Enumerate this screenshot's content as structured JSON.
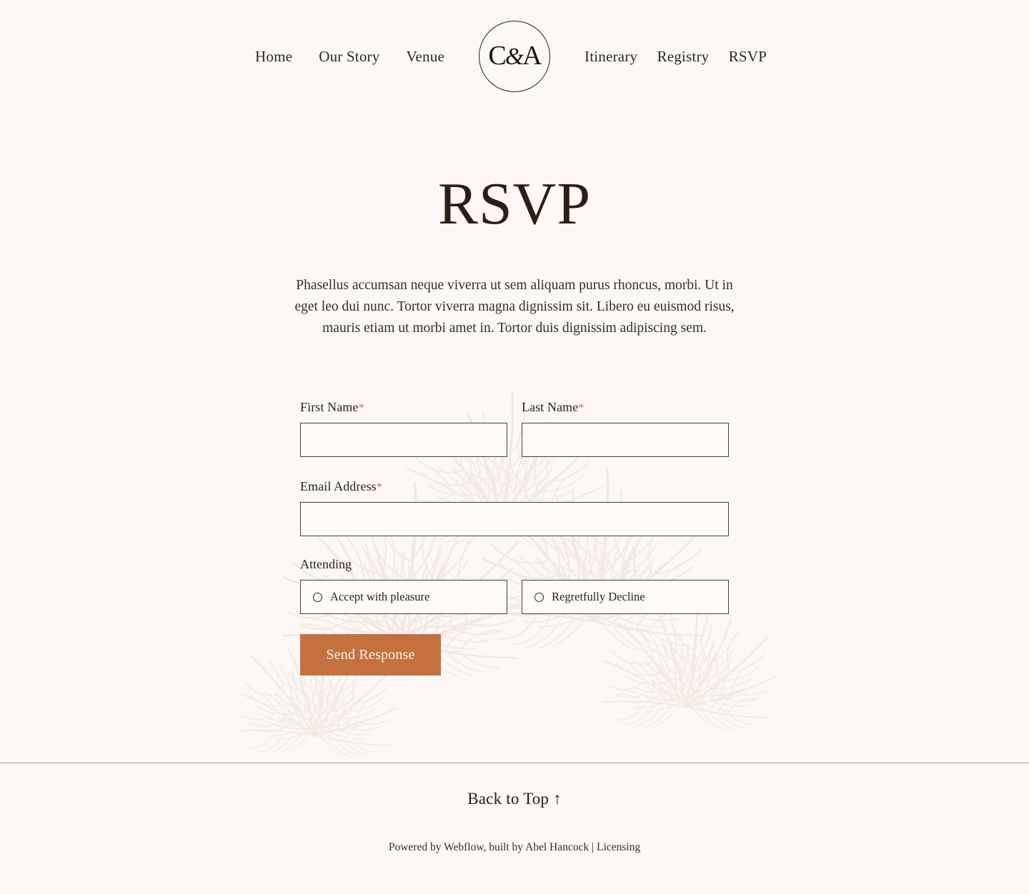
{
  "brand": {
    "logo_monogram_left": "C",
    "logo_monogram_amp": "&",
    "logo_monogram_right": "A"
  },
  "nav": {
    "left_items": [
      {
        "label": "Home"
      },
      {
        "label": "Our Story"
      },
      {
        "label": "Venue"
      }
    ],
    "right_items": [
      {
        "label": "Itinerary"
      },
      {
        "label": "Registry"
      },
      {
        "label": "RSVP"
      }
    ]
  },
  "main": {
    "title": "RSVP",
    "paragraph": "Phasellus accumsan neque viverra ut sem aliquam purus rhoncus, morbi. Ut in eget leo dui nunc. Tortor viverra magna dignissim sit. Libero eu euismod risus, mauris etiam ut morbi amet in. Tortor duis dignissim adipiscing sem."
  },
  "form": {
    "first_name": {
      "label": "First Name",
      "required_marker": "*",
      "value": "",
      "placeholder": ""
    },
    "last_name": {
      "label": "Last Name",
      "required_marker": "*",
      "value": "",
      "placeholder": ""
    },
    "email": {
      "label": "Email Address",
      "required_marker": "*",
      "value": "",
      "placeholder": ""
    },
    "attending": {
      "label": "Attending",
      "options": [
        {
          "label": "Accept with pleasure",
          "selected": false
        },
        {
          "label": "Regretfully Decline",
          "selected": false
        }
      ]
    },
    "submit_label": "Send Response"
  },
  "footer": {
    "back_to_top": "Back to Top ↑",
    "credit_text": "Powered by Webflow, built by Abel Hancock | Licensing"
  },
  "colors": {
    "page_background": "#fdf8f5",
    "text_primary": "#2e2119",
    "heading": "#2e1d15",
    "accent_button": "#c4713f",
    "required_star": "#c0714a",
    "field_border": "#4b3c33",
    "divider": "#a69a93"
  }
}
